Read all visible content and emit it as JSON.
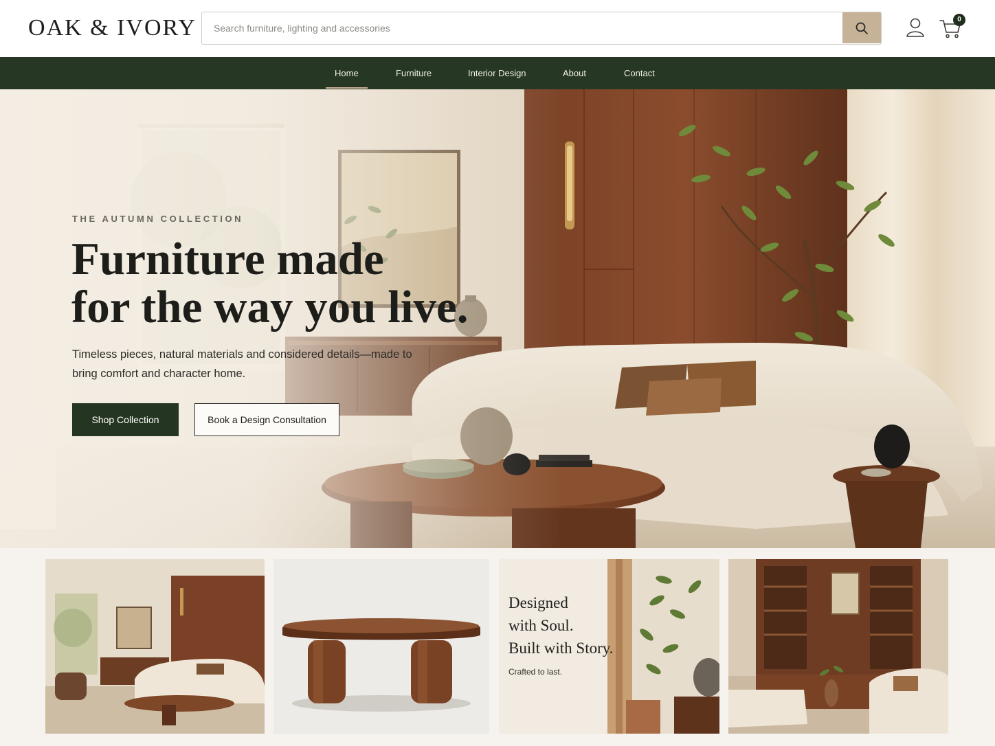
{
  "brand": {
    "logo": "OAK & IVORY"
  },
  "search": {
    "placeholder": "Search furniture, lighting and accessories",
    "value": ""
  },
  "cart": {
    "count": "0"
  },
  "icons": {
    "search": "search-icon",
    "account": "user-icon",
    "cart": "cart-icon"
  },
  "nav": {
    "items": [
      {
        "label": "Home",
        "active": true
      },
      {
        "label": "Furniture",
        "active": false
      },
      {
        "label": "Interior Design",
        "active": false
      },
      {
        "label": "About",
        "active": false
      },
      {
        "label": "Contact",
        "active": false
      }
    ]
  },
  "hero": {
    "eyebrow": "THE AUTUMN COLLECTION",
    "headline_line1": "Furniture made",
    "headline_line2": "for the way you live.",
    "subcopy": "Timeless pieces, natural materials and considered details—made to bring comfort and character home.",
    "primary_cta": "Shop Collection",
    "secondary_cta": "Book a Design Consultation"
  },
  "tiles": {
    "story": {
      "line1": "Designed",
      "line2": "with Soul.",
      "line3": "Built with Story.",
      "subline": "Crafted to last."
    }
  },
  "colors": {
    "nav_bg": "#263823",
    "primary_button": "#243521",
    "accent_tan": "#c6b397",
    "walnut": "#7a4126"
  }
}
